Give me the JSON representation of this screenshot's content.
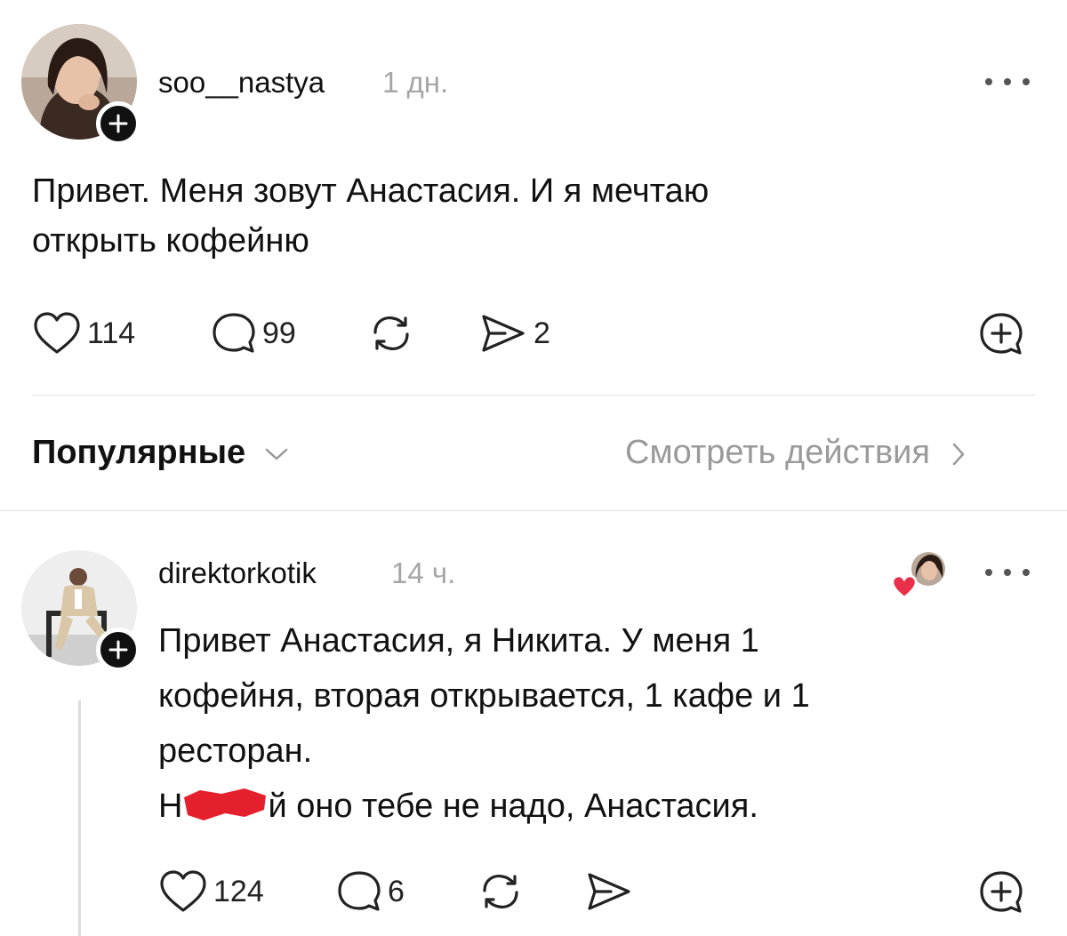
{
  "post": {
    "username": "soo__nastya",
    "time": "1 дн.",
    "text_line1": "Привет. Меня зовут Анастасия. И я мечтаю",
    "text_line2": "открыть кофейню",
    "likes": "114",
    "comments": "99",
    "shares": "2"
  },
  "filter": {
    "sort_label": "Популярные",
    "activity_label": "Смотреть действия"
  },
  "reply": {
    "username": "direktorkotik",
    "time": "14 ч.",
    "line1": "Привет Анастасия, я Никита. У меня 1",
    "line2": "кофейня, вторая открывается, 1 кафе и 1",
    "line3": "ресторан.",
    "line4_prefix": "Н",
    "line4_suffix": "й оно тебе не надо, Анастасия.",
    "likes": "124",
    "comments": "6"
  },
  "icons": {
    "like": "heart-icon",
    "comment": "comment-bubble-icon",
    "repost": "repost-icon",
    "share": "send-icon",
    "more": "more-dots-icon",
    "follow": "plus-icon",
    "quote": "add-comment-icon",
    "sort": "chevron-down-icon",
    "activity": "chevron-right-icon"
  },
  "colors": {
    "text": "#111111",
    "muted": "#a6a6a6",
    "liked_heart": "#e8304a",
    "redaction": "#e4202c"
  }
}
